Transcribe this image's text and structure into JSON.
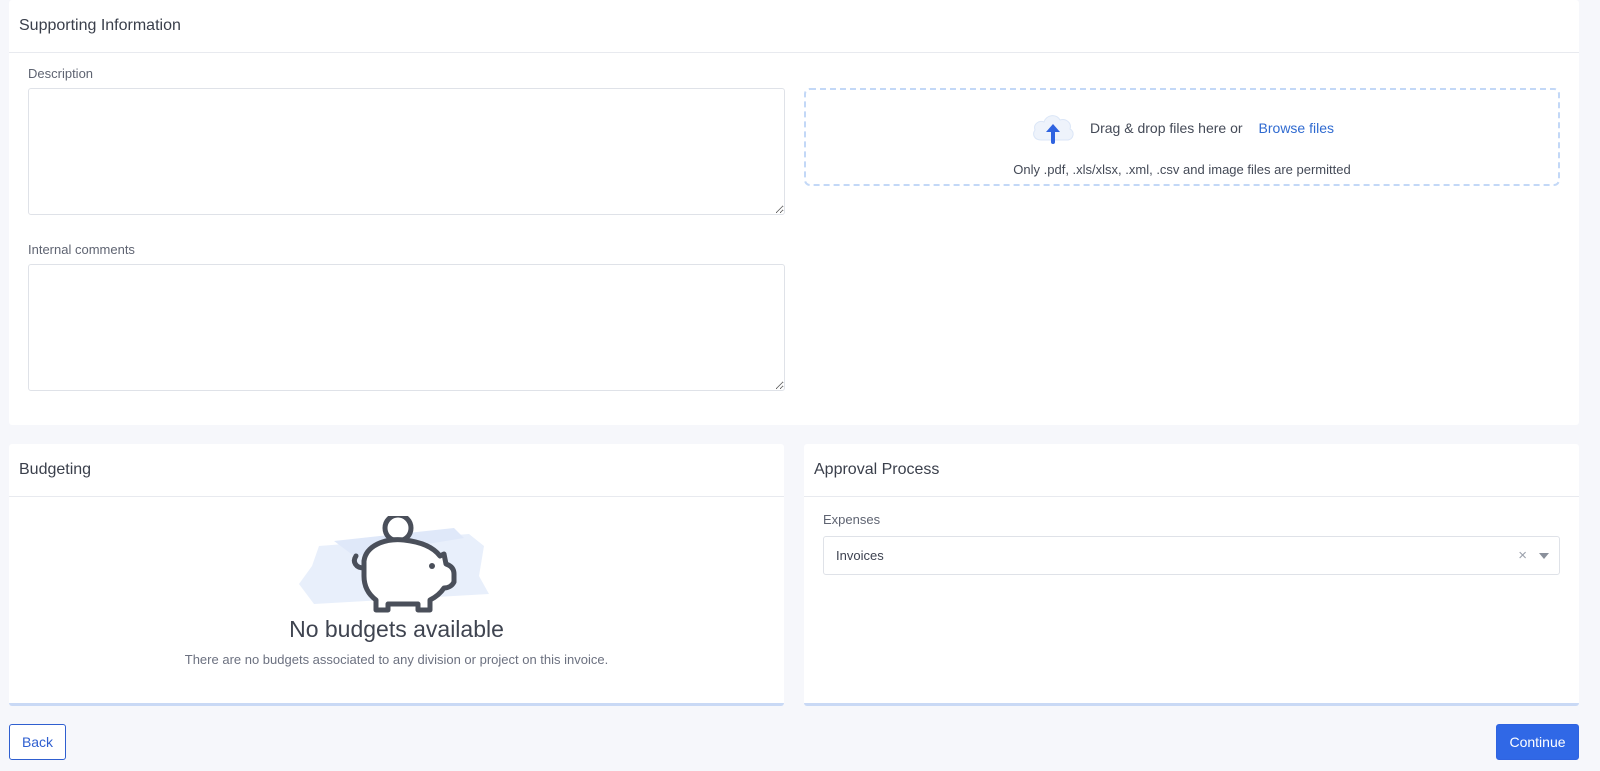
{
  "supporting": {
    "title": "Supporting Information",
    "description_label": "Description",
    "description_value": "",
    "comments_label": "Internal comments",
    "comments_value": "",
    "dropzone": {
      "text": "Drag & drop files here or",
      "browse_label": "Browse files",
      "note": "Only .pdf, .xls/xlsx, .xml, .csv and image files are permitted",
      "icon": "cloud-upload-icon"
    }
  },
  "budgeting": {
    "title": "Budgeting",
    "empty_title": "No budgets available",
    "empty_text": "There are no budgets associated to any division or project on this invoice.",
    "icon": "piggy-bank-icon"
  },
  "approval": {
    "title": "Approval Process",
    "expenses_label": "Expenses",
    "expenses_value": "Invoices",
    "clear_glyph": "×"
  },
  "footer": {
    "back_label": "Back",
    "continue_label": "Continue"
  },
  "colors": {
    "accent": "#3068e6",
    "dropzone_border": "#c3d8f7",
    "background": "#f6f7fb"
  }
}
